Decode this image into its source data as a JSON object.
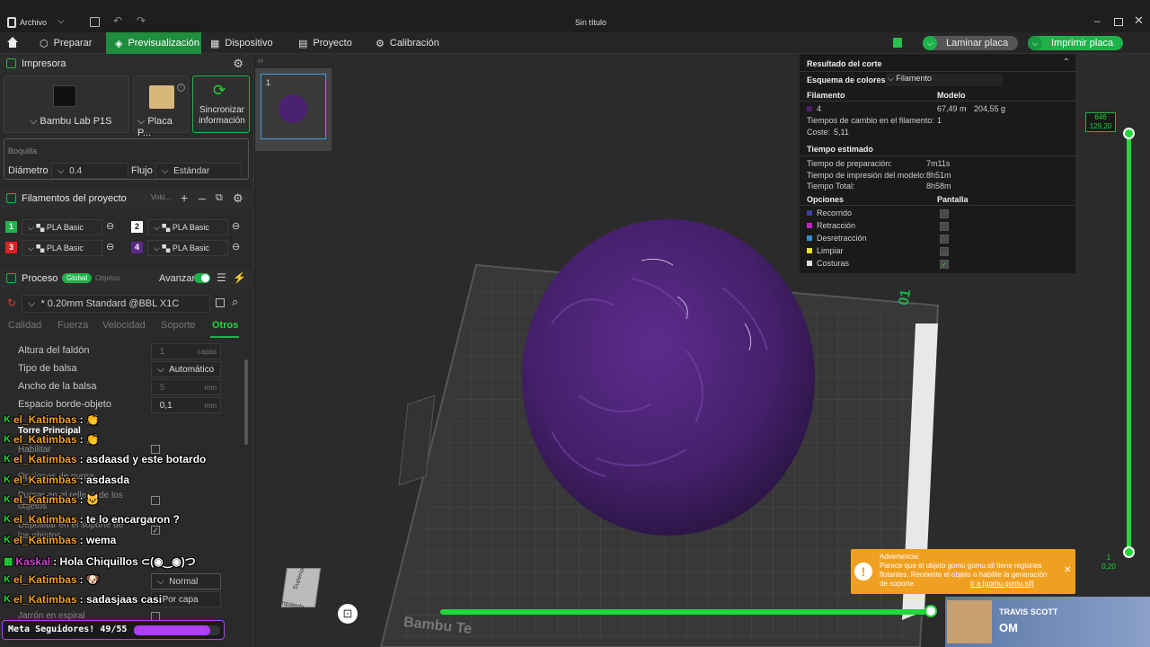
{
  "titlebar": {
    "menu_label": "Archivo",
    "title": "Sin título"
  },
  "tabs": [
    {
      "label": "Preparar"
    },
    {
      "label": "Previsualización"
    },
    {
      "label": "Dispositivo"
    },
    {
      "label": "Proyecto"
    },
    {
      "label": "Calibración"
    }
  ],
  "actions": {
    "slice_label": "Laminar placa",
    "print_label": "Imprimir placa"
  },
  "printer": {
    "section": "Impresora",
    "name": "Bambu Lab P1S",
    "plate": "Placa P...",
    "sync_label": "Sincronizar información",
    "nozzle_title": "Boquilla",
    "diameter_label": "Diámetro",
    "diameter_value": "0.4",
    "flow_label": "Flujo",
    "flow_value": "Estándar"
  },
  "filaments": {
    "section": "Filamentos del proyecto",
    "volume_label": "Volú...",
    "items": [
      {
        "num": "1",
        "name": "PLA Basic",
        "color": "#22b14c"
      },
      {
        "num": "2",
        "name": "PLA Basic",
        "color": "#ffffff"
      },
      {
        "num": "3",
        "name": "PLA Basic",
        "color": "#e02020"
      },
      {
        "num": "4",
        "name": "PLA Basic",
        "color": "#5b2a86"
      }
    ]
  },
  "process": {
    "section": "Proceso",
    "global": "Global",
    "objects": "Objetos",
    "advanced": "Avanzar",
    "profile": "* 0.20mm Standard @BBL X1C",
    "subtabs": [
      "Calidad",
      "Fuerza",
      "Velocidad",
      "Soporte",
      "Otros"
    ],
    "rows": [
      {
        "label": "Altura del faldón",
        "value": "1",
        "unit": "capas"
      },
      {
        "label": "Tipo de balsa",
        "value": "Automático",
        "unit": ""
      },
      {
        "label": "Ancho de la balsa",
        "value": "5",
        "unit": "mm"
      },
      {
        "label": "Espacio borde-objeto",
        "value": "0,1",
        "unit": "mm"
      }
    ],
    "tower_label": "Torre Principal",
    "enable_label": "Habilitar",
    "purge_label": "Opciones de purga",
    "purge_fill": "Purgar en el relleno de los objetos",
    "purge_support": "Depositar en el soporte de los objetos",
    "normal_value": "Normal",
    "perlayer_value": "Por capa",
    "vase_label": "Jarrón en espiral"
  },
  "chat": [
    {
      "user": "el_Katimbas",
      "text": ":",
      "emote": "👏"
    },
    {
      "user": "el_Katimbas",
      "text": ":",
      "emote": "👏"
    },
    {
      "user": "el_Katimbas",
      "text": ": asdaasd y este botardo",
      "emote": ""
    },
    {
      "user": "el_Katimbas",
      "text": ": asdasda",
      "emote": ""
    },
    {
      "user": "el_Katimbas",
      "text": ":",
      "emote": "🐱"
    },
    {
      "user": "el_Katimbas",
      "text": ": te lo encargaron ?",
      "emote": ""
    },
    {
      "user": "el_Katimbas",
      "text": ": wema",
      "emote": ""
    },
    {
      "user": "Kaskal",
      "text": ": Hola Chiquillos ⊂(◉‿◉)つ",
      "emote": ""
    },
    {
      "user": "el_Katimbas",
      "text": ":",
      "emote": "🐶"
    },
    {
      "user": "el_Katimbas",
      "text": ": sadasjaas casi",
      "emote": ""
    }
  ],
  "goal": {
    "label": "Meta Seguidores! 49/55",
    "progress": 0.89
  },
  "plate_thumb": {
    "number": "1"
  },
  "result": {
    "title": "Resultado del corte",
    "scheme_label": "Esquema de colores",
    "scheme_value": "Filamento",
    "col_filament": "Filamento",
    "col_model": "Modelo",
    "filament_id": "4",
    "filament_len": "67,49 m",
    "filament_weight": "204,55 g",
    "changes": "Tiempos de cambio en el filamento:",
    "changes_val": "1",
    "cost": "Coste:",
    "cost_val": "5,11",
    "time_title": "Tiempo estimado",
    "prep": "Tiempo de preparación:",
    "prep_val": "7m11s",
    "model_time": "Tiempo de impresión del modelo:",
    "model_time_val": "8h51m",
    "total": "Tiempo Total:",
    "total_val": "8h58m",
    "options": "Opciones",
    "display": "Pantalla",
    "legend": [
      {
        "label": "Recorrido",
        "color": "#3e3ea0",
        "checked": false
      },
      {
        "label": "Retracción",
        "color": "#c020c0",
        "checked": false
      },
      {
        "label": "Desretracción",
        "color": "#3090d0",
        "checked": false
      },
      {
        "label": "Limpiar",
        "color": "#e8e020",
        "checked": false
      },
      {
        "label": "Costuras",
        "color": "#e0e0e0",
        "checked": true
      }
    ]
  },
  "slider": {
    "top_val1": "646",
    "top_val2": "129,20",
    "bot_val1": "1",
    "bot_val2": "0,20"
  },
  "warning": {
    "title": "Advertencia:",
    "text": "Parece que el objeto gomu gomu.stl tiene regiones flotantes. Reoriente el objeto o habilite la generación de soporte.",
    "link": "Ir a [gomu gomu.stl]"
  },
  "plate_label": "Bambu Te",
  "plate_side_label": "01",
  "cube": {
    "top": "Superior",
    "left": "Izquierda"
  },
  "music": {
    "artist": "TRAVIS SCOTT",
    "extra": "OM"
  }
}
